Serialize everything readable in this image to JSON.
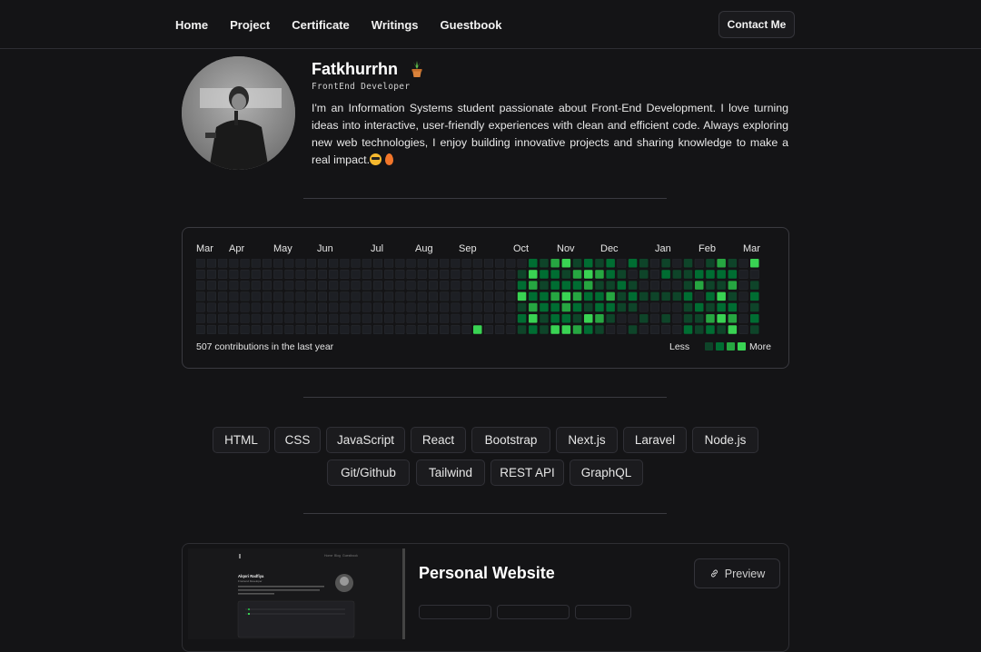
{
  "nav": {
    "links": [
      "Home",
      "Project",
      "Certificate",
      "Writings",
      "Guestbook"
    ],
    "contact_label": "Contact Me"
  },
  "profile": {
    "name": "Fatkhurrhn",
    "role": "FrontEnd Developer",
    "bio": "I'm an Information Systems student passionate about Front-End Development. I love turning ideas into interactive, user-friendly experiences with clean and efficient code. Always exploring new web technologies, I enjoy building innovative projects and sharing knowledge to make a real impact.",
    "name_icon": "potted-plant-icon",
    "bio_emojis": [
      "sunglasses-emoji-icon",
      "fire-emoji-icon"
    ]
  },
  "contributions": {
    "months": [
      "Mar",
      "Apr",
      "May",
      "Jun",
      "Jul",
      "Aug",
      "Sep",
      "Oct",
      "Nov",
      "Dec",
      "Jan",
      "Feb",
      "Mar"
    ],
    "total_text": "507 contributions in the last year",
    "legend_less": "Less",
    "legend_more": "More",
    "levels": [
      "#1d1f24",
      "#0e4429",
      "#006d32",
      "#26a641",
      "#39d353"
    ],
    "weeks": [
      [
        0,
        0,
        0,
        0,
        0,
        0,
        0
      ],
      [
        0,
        0,
        0,
        0,
        0,
        0,
        0
      ],
      [
        0,
        0,
        0,
        0,
        0,
        0,
        0
      ],
      [
        0,
        0,
        0,
        0,
        0,
        0,
        0
      ],
      [
        0,
        0,
        0,
        0,
        0,
        0,
        0
      ],
      [
        0,
        0,
        0,
        0,
        0,
        0,
        0
      ],
      [
        0,
        0,
        0,
        0,
        0,
        0,
        0
      ],
      [
        0,
        0,
        0,
        0,
        0,
        0,
        0
      ],
      [
        0,
        0,
        0,
        0,
        0,
        0,
        0
      ],
      [
        0,
        0,
        0,
        0,
        0,
        0,
        0
      ],
      [
        0,
        0,
        0,
        0,
        0,
        0,
        0
      ],
      [
        0,
        0,
        0,
        0,
        0,
        0,
        0
      ],
      [
        0,
        0,
        0,
        0,
        0,
        0,
        0
      ],
      [
        0,
        0,
        0,
        0,
        0,
        0,
        0
      ],
      [
        0,
        0,
        0,
        0,
        0,
        0,
        0
      ],
      [
        0,
        0,
        0,
        0,
        0,
        0,
        0
      ],
      [
        0,
        0,
        0,
        0,
        0,
        0,
        0
      ],
      [
        0,
        0,
        0,
        0,
        0,
        0,
        0
      ],
      [
        0,
        0,
        0,
        0,
        0,
        0,
        0
      ],
      [
        0,
        0,
        0,
        0,
        0,
        0,
        0
      ],
      [
        0,
        0,
        0,
        0,
        0,
        0,
        0
      ],
      [
        0,
        0,
        0,
        0,
        0,
        0,
        0
      ],
      [
        0,
        0,
        0,
        0,
        0,
        0,
        0
      ],
      [
        0,
        0,
        0,
        0,
        0,
        0,
        0
      ],
      [
        0,
        0,
        0,
        0,
        0,
        0,
        0
      ],
      [
        0,
        0,
        0,
        0,
        0,
        0,
        4
      ],
      [
        0,
        0,
        0,
        0,
        0,
        0,
        0
      ],
      [
        0,
        0,
        0,
        0,
        0,
        0,
        0
      ],
      [
        0,
        0,
        0,
        0,
        0,
        0,
        0
      ],
      [
        0,
        1,
        2,
        4,
        1,
        2,
        1
      ],
      [
        2,
        4,
        3,
        2,
        3,
        4,
        2
      ],
      [
        1,
        2,
        1,
        2,
        2,
        1,
        1
      ],
      [
        3,
        2,
        2,
        3,
        2,
        2,
        4
      ],
      [
        4,
        1,
        2,
        4,
        3,
        2,
        4
      ],
      [
        1,
        3,
        2,
        3,
        2,
        1,
        3
      ],
      [
        2,
        4,
        3,
        2,
        1,
        4,
        2
      ],
      [
        1,
        3,
        1,
        2,
        2,
        3,
        1
      ],
      [
        2,
        2,
        1,
        3,
        2,
        1,
        0
      ],
      [
        0,
        1,
        2,
        1,
        1,
        0,
        0
      ],
      [
        2,
        0,
        1,
        2,
        1,
        0,
        1
      ],
      [
        1,
        1,
        0,
        1,
        0,
        1,
        0
      ],
      [
        0,
        0,
        0,
        1,
        0,
        0,
        0
      ],
      [
        1,
        2,
        0,
        1,
        0,
        1,
        0
      ],
      [
        0,
        1,
        0,
        1,
        0,
        0,
        0
      ],
      [
        1,
        1,
        1,
        2,
        1,
        1,
        2
      ],
      [
        0,
        2,
        3,
        0,
        2,
        1,
        1
      ],
      [
        1,
        2,
        1,
        2,
        1,
        3,
        2
      ],
      [
        3,
        2,
        1,
        4,
        2,
        4,
        1
      ],
      [
        1,
        2,
        3,
        1,
        2,
        3,
        4
      ],
      [
        0,
        0,
        0,
        0,
        0,
        0,
        0
      ],
      [
        4,
        0,
        1,
        2,
        1,
        2,
        1
      ]
    ]
  },
  "skills": [
    "HTML",
    "CSS",
    "JavaScript",
    "React",
    "Bootstrap",
    "Next.js",
    "Laravel",
    "Node.js",
    "Git/Github",
    "Tailwind",
    "REST API",
    "GraphQL"
  ],
  "project": {
    "title": "Personal Website",
    "preview_label": "Preview",
    "thumb_name": "Alqori Radfiya",
    "thumb_role": "Frontend Developer",
    "thumb_nav": [
      "Home",
      "Blog",
      "Guestbook"
    ]
  }
}
